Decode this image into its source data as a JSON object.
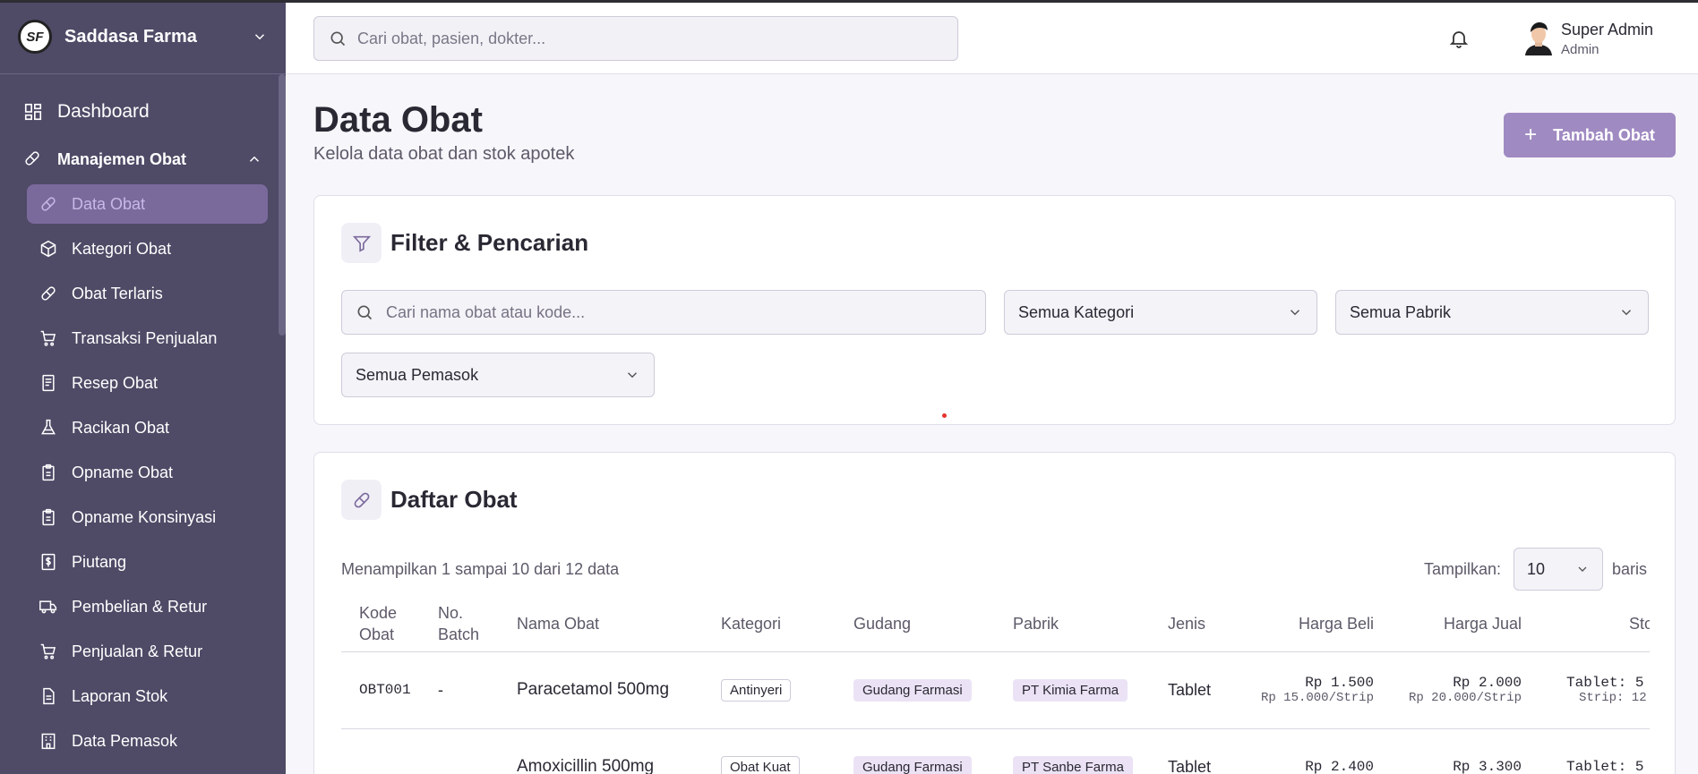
{
  "sidebar": {
    "brand": "Saddasa Farma",
    "logo_text": "SF",
    "dashboard": "Dashboard",
    "group": "Manajemen Obat",
    "items": [
      {
        "label": "Data Obat",
        "icon": "pill-icon"
      },
      {
        "label": "Kategori Obat",
        "icon": "box-icon"
      },
      {
        "label": "Obat Terlaris",
        "icon": "pill-icon"
      },
      {
        "label": "Transaksi Penjualan",
        "icon": "cart-icon"
      },
      {
        "label": "Resep Obat",
        "icon": "document-icon"
      },
      {
        "label": "Racikan Obat",
        "icon": "flask-icon"
      },
      {
        "label": "Opname Obat",
        "icon": "clipboard-icon"
      },
      {
        "label": "Opname Konsinyasi",
        "icon": "clipboard-icon"
      },
      {
        "label": "Piutang",
        "icon": "money-icon"
      },
      {
        "label": "Pembelian & Retur",
        "icon": "truck-icon"
      },
      {
        "label": "Penjualan & Retur",
        "icon": "cart-icon"
      },
      {
        "label": "Laporan Stok",
        "icon": "report-icon"
      },
      {
        "label": "Data Pemasok",
        "icon": "building-icon"
      }
    ]
  },
  "header": {
    "search_placeholder": "Cari obat, pasien, dokter...",
    "user_name": "Super Admin",
    "user_role": "Admin"
  },
  "page": {
    "title": "Data Obat",
    "subtitle": "Kelola data obat dan stok apotek",
    "add_button": "Tambah Obat"
  },
  "filter": {
    "title": "Filter & Pencarian",
    "search_placeholder": "Cari nama obat atau kode...",
    "kategori": "Semua Kategori",
    "pabrik": "Semua Pabrik",
    "pemasok": "Semua Pemasok"
  },
  "list": {
    "title": "Daftar Obat",
    "showing": "Menampilkan 1 sampai 10 dari 12 data",
    "rows_label": "Tampilkan:",
    "rows_value": "10",
    "rows_suffix": "baris",
    "columns": [
      "Kode Obat",
      "No. Batch",
      "Nama Obat",
      "Kategori",
      "Gudang",
      "Pabrik",
      "Jenis",
      "Harga Beli",
      "Harga Jual",
      "Stok"
    ],
    "rows": [
      {
        "kode": "OBT001",
        "batch": "-",
        "nama": "Paracetamol 500mg",
        "kategori": "Antinyeri",
        "gudang": "Gudang Farmasi",
        "pabrik": "PT Kimia Farma",
        "jenis": "Tablet",
        "harga_beli": "Rp 1.500",
        "harga_beli_sub": "Rp 15.000/Strip",
        "harga_jual": "Rp 2.000",
        "harga_jual_sub": "Rp 20.000/Strip",
        "stok": "Tablet: 5",
        "stok_sub": "Strip: 12"
      },
      {
        "kode": "",
        "batch": "",
        "nama": "Amoxicillin 500mg",
        "kategori": "Obat Kuat",
        "gudang": "Gudang Farmasi",
        "pabrik": "PT Sanbe Farma",
        "jenis": "Tablet",
        "harga_beli": "Rp 2.400",
        "harga_beli_sub": "",
        "harga_jual": "Rp 3.300",
        "harga_jual_sub": "",
        "stok": "Tablet: 5",
        "stok_sub": ""
      }
    ]
  }
}
